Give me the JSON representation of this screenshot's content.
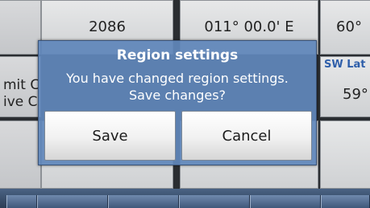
{
  "background": {
    "cells_top": [
      "",
      "2086",
      "011° 00.0' E",
      "60°"
    ],
    "sw_lat_header": "SW Lat",
    "sw_lat_value": "59°",
    "left_text_line1": "mit C",
    "left_text_line2": "ive C"
  },
  "dialog": {
    "title": "Region settings",
    "message_line1": "You have changed region settings.",
    "message_line2": "Save changes?",
    "save_label": "Save",
    "cancel_label": "Cancel"
  },
  "colors": {
    "dialog_bg": "#6086ba",
    "header_accent": "#2f5faa"
  }
}
